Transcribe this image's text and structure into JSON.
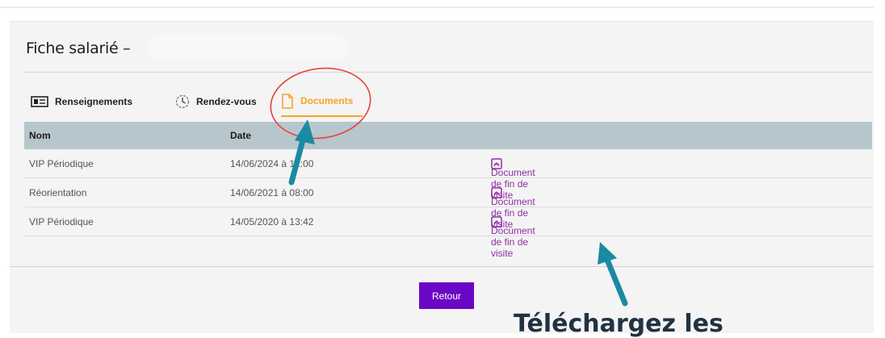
{
  "page": {
    "title": "Fiche salarié –"
  },
  "tabs": [
    {
      "label": "Renseignements",
      "icon": "id-card-icon"
    },
    {
      "label": "Rendez-vous",
      "icon": "clock-icon"
    },
    {
      "label": "Documents",
      "icon": "document-icon",
      "active": true
    }
  ],
  "table": {
    "headers": [
      "Nom",
      "Date"
    ],
    "rows": [
      {
        "nom": "VIP Périodique",
        "date": "14/06/2024 à 12:00",
        "doc": "Document de fin de visite"
      },
      {
        "nom": "Réorientation",
        "date": "14/06/2021 à 08:00",
        "doc": "Document de fin de visite"
      },
      {
        "nom": "VIP Périodique",
        "date": "14/05/2020 à 13:42",
        "doc": "Document de fin de visite"
      }
    ]
  },
  "actions": {
    "retour_label": "Retour"
  },
  "annotation": {
    "caption": "Téléchargez les"
  },
  "colors": {
    "accent_tab": "#f5a524",
    "link": "#8e2ea1",
    "button": "#6a07c4",
    "header_bg": "#b7c6cc",
    "arrow": "#1b8aa3",
    "circle": "#e8413a"
  }
}
